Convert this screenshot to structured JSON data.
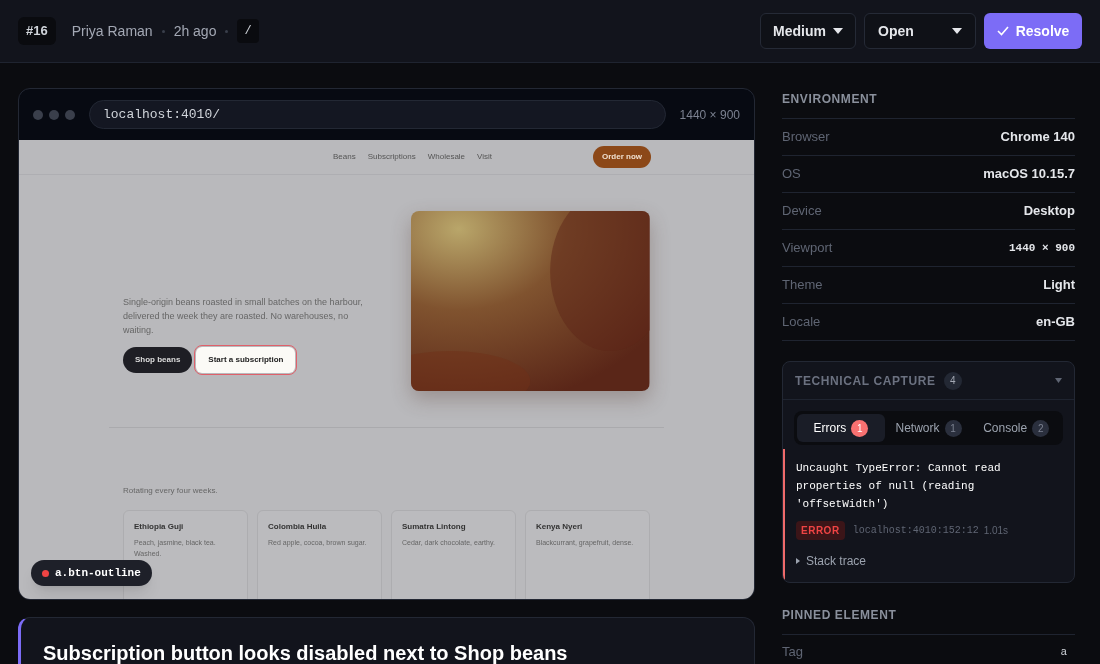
{
  "header": {
    "id": "#16",
    "author": "Priya Raman",
    "time": "2h ago",
    "path": "/",
    "priority": "Medium",
    "status": "Open",
    "resolve": "Resolve"
  },
  "preview": {
    "url": "localhost:4010/",
    "size": "1440 × 900",
    "site": {
      "nav": [
        "Beans",
        "Subscriptions",
        "Wholesale",
        "Visit"
      ],
      "cta": "Order now",
      "hero_text": "Single-origin beans roasted in small batches on the harbour, delivered the week they are roasted. No warehouses, no waiting.",
      "buttons": [
        {
          "label": "Shop beans",
          "kind": "solid",
          "highlighted": false
        },
        {
          "label": "Start a subscription",
          "kind": "outline",
          "highlighted": true
        }
      ],
      "section_text": "Rotating every four weeks.",
      "cards": [
        {
          "title": "Ethiopia Guji",
          "text": "Peach, jasmine, black tea. Washed."
        },
        {
          "title": "Colombia Huila",
          "text": "Red apple, cocoa, brown sugar."
        },
        {
          "title": "Sumatra Lintong",
          "text": "Cedar, dark chocolate, earthy."
        },
        {
          "title": "Kenya Nyeri",
          "text": "Blackcurrant, grapefruit, dense."
        }
      ]
    },
    "selector": "a.btn-outline"
  },
  "issue_title": "Subscription button looks disabled next to Shop beans",
  "environment": {
    "title": "ENVIRONMENT",
    "rows": [
      {
        "label": "Browser",
        "value": "Chrome 140",
        "kind": "text"
      },
      {
        "label": "OS",
        "value": "macOS 10.15.7",
        "kind": "text"
      },
      {
        "label": "Device",
        "value": "Desktop",
        "kind": "text"
      },
      {
        "label": "Viewport",
        "value": "1440 × 900",
        "kind": "mono"
      },
      {
        "label": "Theme",
        "value": "Light",
        "kind": "text"
      },
      {
        "label": "Locale",
        "value": "en-GB",
        "kind": "text"
      }
    ]
  },
  "capture": {
    "title": "TECHNICAL CAPTURE",
    "count": "4",
    "tabs": [
      {
        "label": "Errors",
        "count": "1",
        "selected": true,
        "color": "#f87171"
      },
      {
        "label": "Network",
        "count": "1",
        "selected": false,
        "color": "#2a2f3d"
      },
      {
        "label": "Console",
        "count": "2",
        "selected": false,
        "color": "#2a2f3d"
      }
    ],
    "error": {
      "message": "Uncaught TypeError: Cannot read properties of null (reading 'offsetWidth')",
      "level": "ERROR",
      "location": "localhost:4010:152:12",
      "time": "1.01s"
    },
    "stack": "Stack trace"
  },
  "pinned": {
    "title": "PINNED ELEMENT",
    "rows": [
      {
        "label": "Tag",
        "value": "a"
      }
    ]
  }
}
